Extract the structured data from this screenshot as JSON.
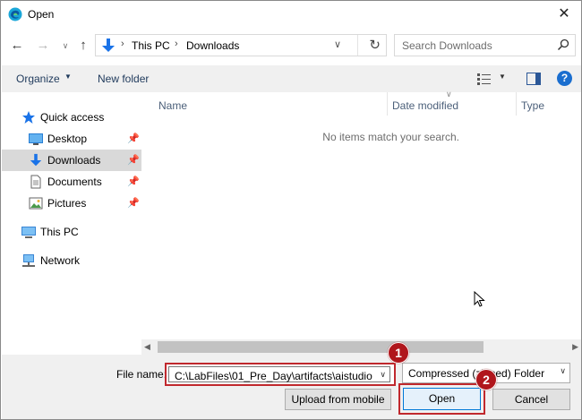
{
  "window": {
    "title": "Open",
    "close_glyph": "✕"
  },
  "address": {
    "crumbs": [
      "This PC",
      "Downloads"
    ],
    "search_placeholder": "Search Downloads"
  },
  "toolbar": {
    "organize": "Organize",
    "new_folder": "New folder",
    "help": "?"
  },
  "nav": {
    "quick_access": "Quick access",
    "items": [
      {
        "label": "Desktop",
        "pinned": true
      },
      {
        "label": "Downloads",
        "pinned": true,
        "selected": true
      },
      {
        "label": "Documents",
        "pinned": true
      },
      {
        "label": "Pictures",
        "pinned": true
      }
    ],
    "this_pc": "This PC",
    "network": "Network"
  },
  "list": {
    "columns": [
      "Name",
      "Date modified",
      "Type"
    ],
    "empty_message": "No items match your search."
  },
  "bottom": {
    "file_name_label": "File name:",
    "file_name_value": "C:\\LabFiles\\01_Pre_Day\\artifacts\\aistudio",
    "file_type_value": "Compressed (zipped) Folder",
    "upload_label": "Upload from mobile",
    "open_label": "Open",
    "cancel_label": "Cancel"
  },
  "annotations": {
    "badge1": "1",
    "badge2": "2",
    "color": "#b0161c"
  },
  "icons": [
    "edge-icon",
    "back-arrow-icon",
    "forward-arrow-icon",
    "recent-chevron-icon",
    "up-arrow-icon",
    "download-icon",
    "refresh-icon",
    "search-icon",
    "view-icon",
    "preview-pane-icon",
    "help-icon",
    "star-icon",
    "desktop-icon",
    "document-icon",
    "pictures-icon",
    "pc-icon",
    "network-icon",
    "pin-icon"
  ]
}
